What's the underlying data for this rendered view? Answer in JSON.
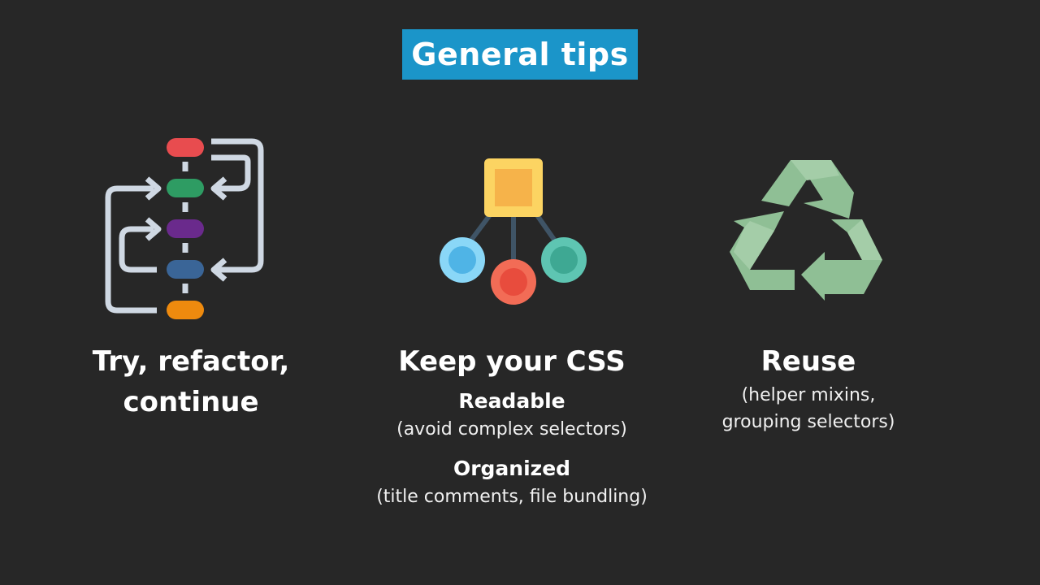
{
  "title": "General tips",
  "columns": {
    "iterate": {
      "heading_line1": "Try, refactor,",
      "heading_line2": "continue",
      "icon": "workflow-icon"
    },
    "css": {
      "heading": "Keep your CSS",
      "readable": {
        "label": "Readable",
        "detail": "(avoid complex selectors)"
      },
      "organized": {
        "label": "Organized",
        "detail": "(title comments, file bundling)"
      },
      "icon": "hierarchy-icon"
    },
    "reuse": {
      "heading": "Reuse",
      "detail_line1": "(helper mixins,",
      "detail_line2": "grouping selectors)",
      "icon": "recycle-icon"
    }
  },
  "colors": {
    "background": "#272727",
    "title_box": "#1b95c9",
    "text": "#ffffff"
  }
}
